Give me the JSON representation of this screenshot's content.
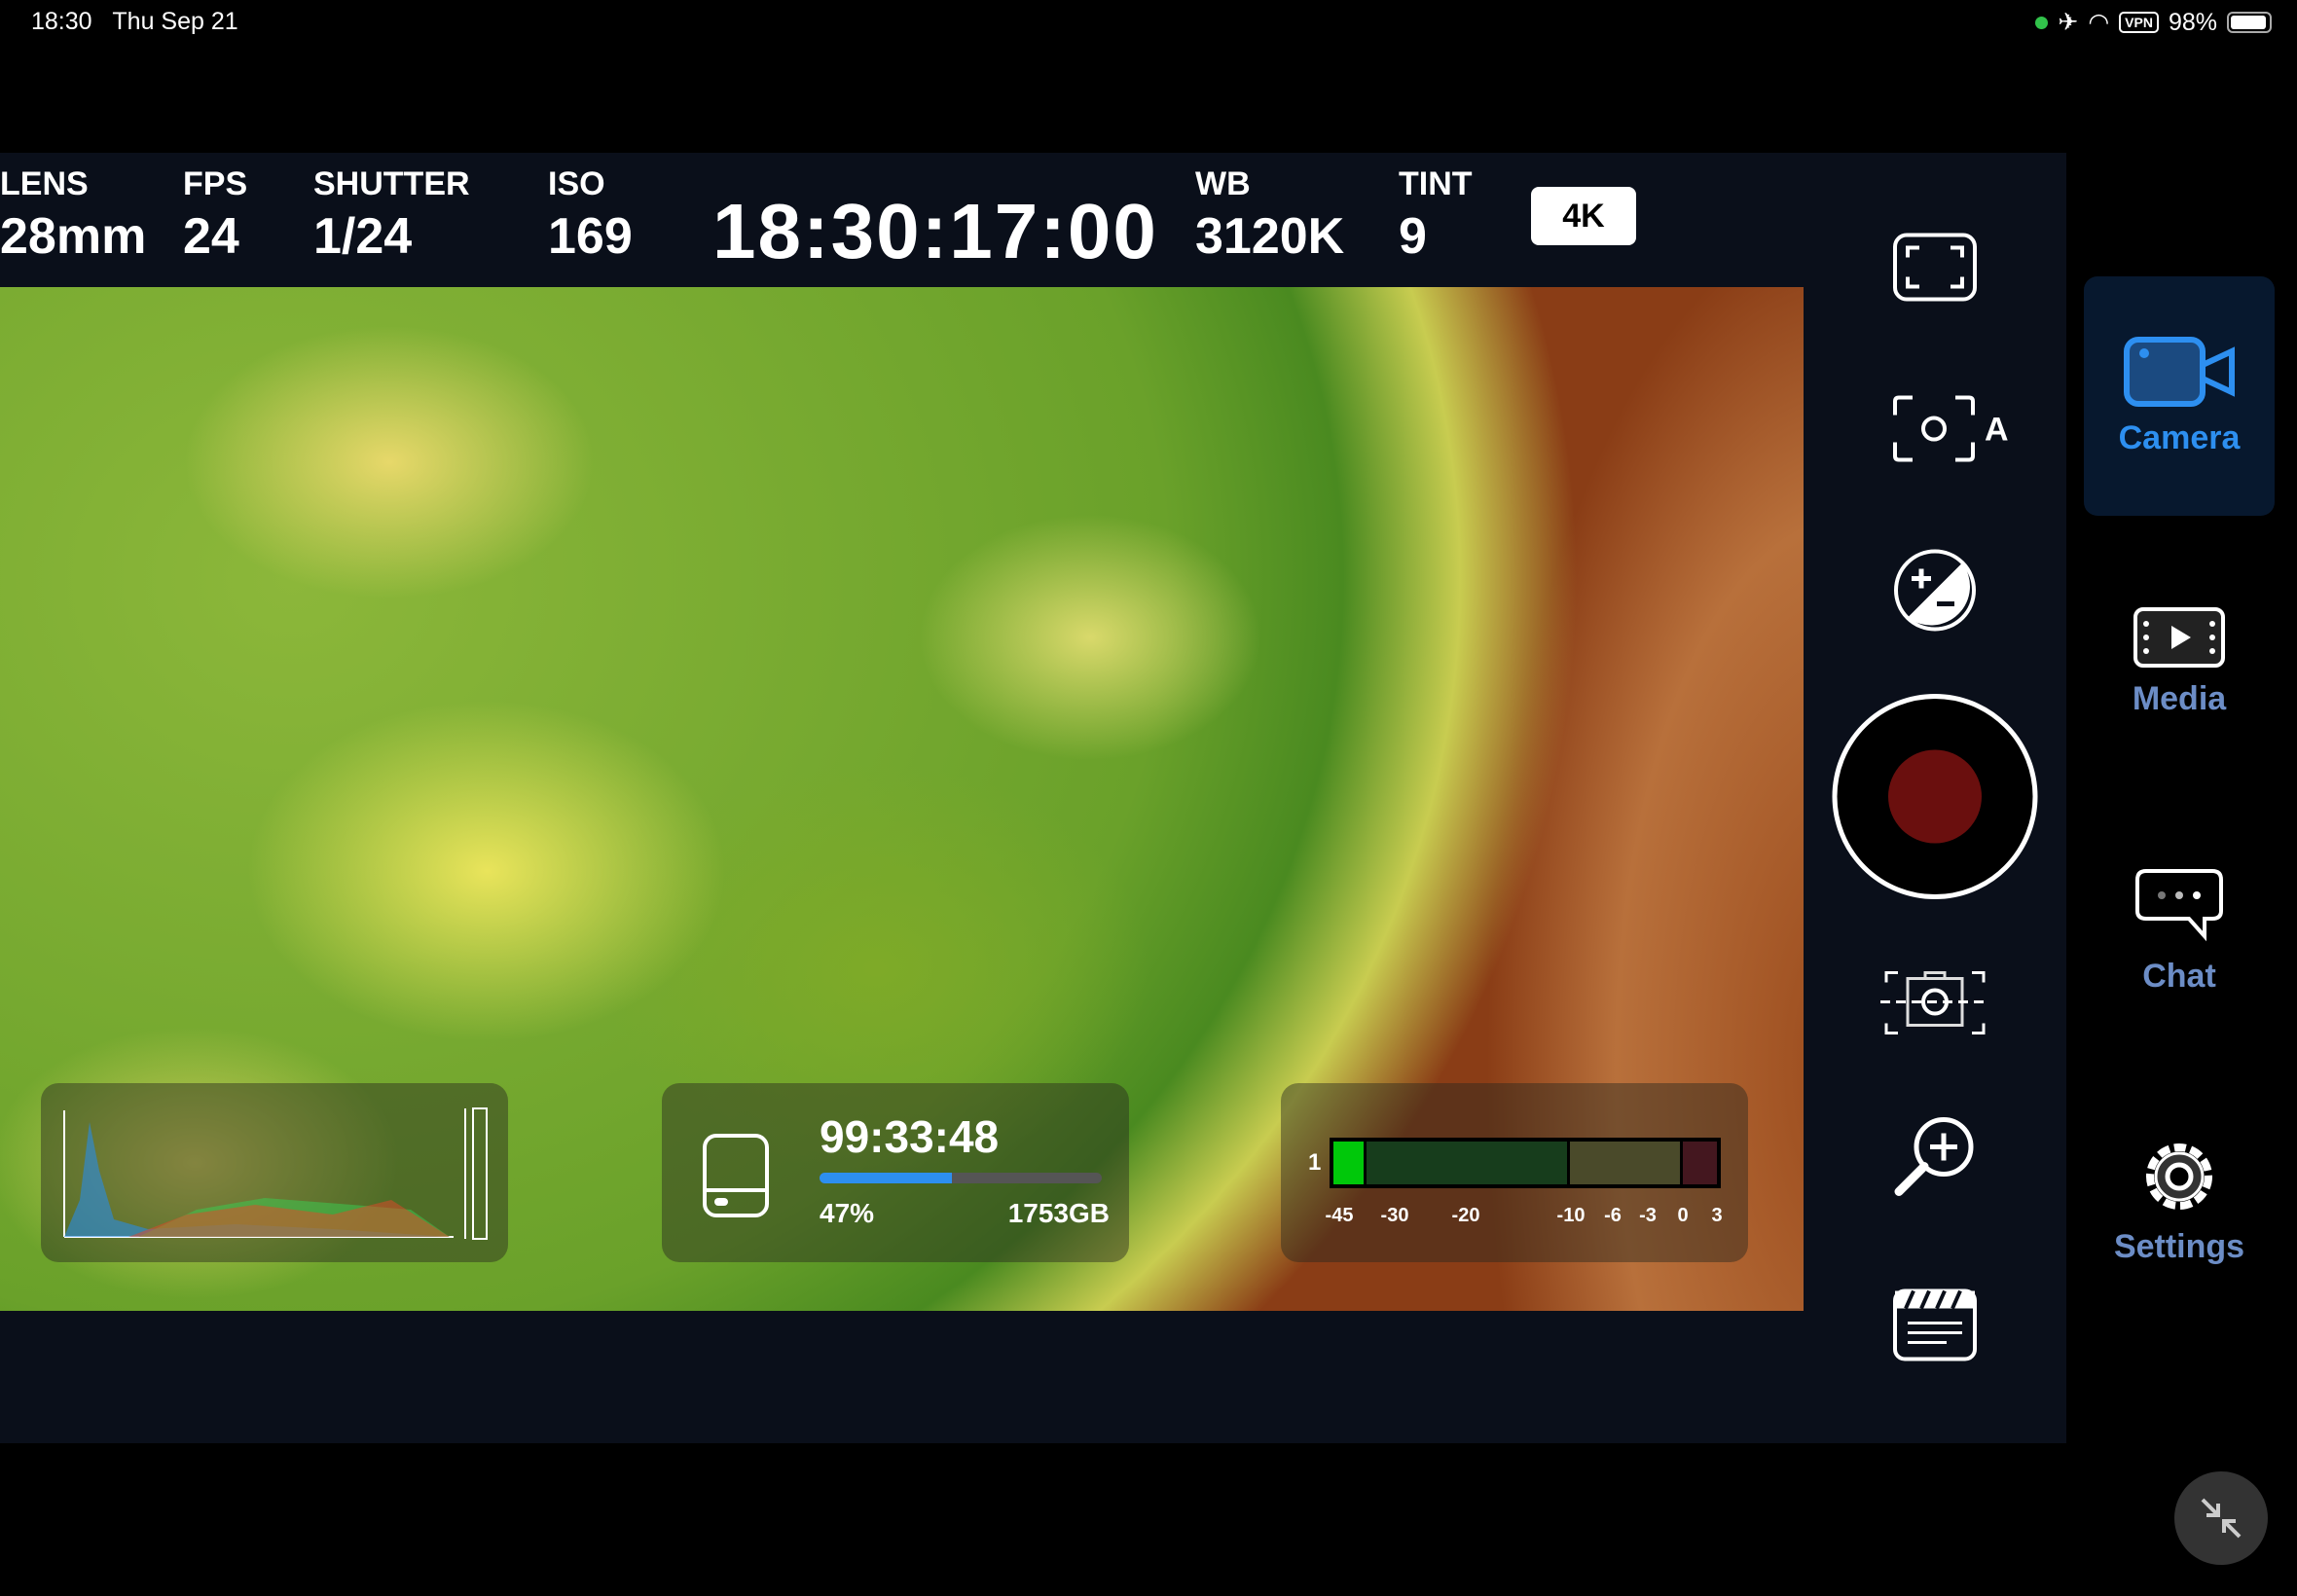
{
  "status_bar": {
    "time": "18:30",
    "date": "Thu Sep 21",
    "vpn": "VPN",
    "battery": "98%",
    "battery_level": 0.98
  },
  "header": {
    "params": [
      {
        "label": "LENS",
        "value": "28mm"
      },
      {
        "label": "FPS",
        "value": "24"
      },
      {
        "label": "SHUTTER",
        "value": "1/24"
      },
      {
        "label": "ISO",
        "value": "169"
      }
    ],
    "timecode": "18:30:17:00",
    "wb": {
      "label": "WB",
      "value": "3120K"
    },
    "tint": {
      "label": "TINT",
      "value": "9"
    },
    "resolution_badge": "4K"
  },
  "storage": {
    "remaining_time": "99:33:48",
    "percent_label": "47%",
    "percent": 47,
    "size": "1753GB",
    "accent": "#2d8ff0"
  },
  "audio_meter": {
    "channel": "1",
    "ticks": [
      "-45",
      "-30",
      "-20",
      "-10",
      "-6",
      "-3",
      "0",
      "3"
    ],
    "level_db": -40,
    "colors": {
      "active": "#00c80a",
      "green": "#173d1c",
      "yellow": "#4a4a2a",
      "red": "#44171f"
    }
  },
  "toolbar": [
    "fullscreen-icon",
    "auto-focus-icon",
    "exposure-icon",
    "record-button",
    "camera-capture-icon",
    "zoom-in-icon",
    "clapperboard-icon"
  ],
  "nav": {
    "items": [
      {
        "label": "Camera",
        "icon": "video-camera-icon",
        "active": true
      },
      {
        "label": "Media",
        "icon": "film-play-icon"
      },
      {
        "label": "Chat",
        "icon": "chat-bubble-icon"
      },
      {
        "label": "Settings",
        "icon": "gear-icon"
      }
    ]
  }
}
